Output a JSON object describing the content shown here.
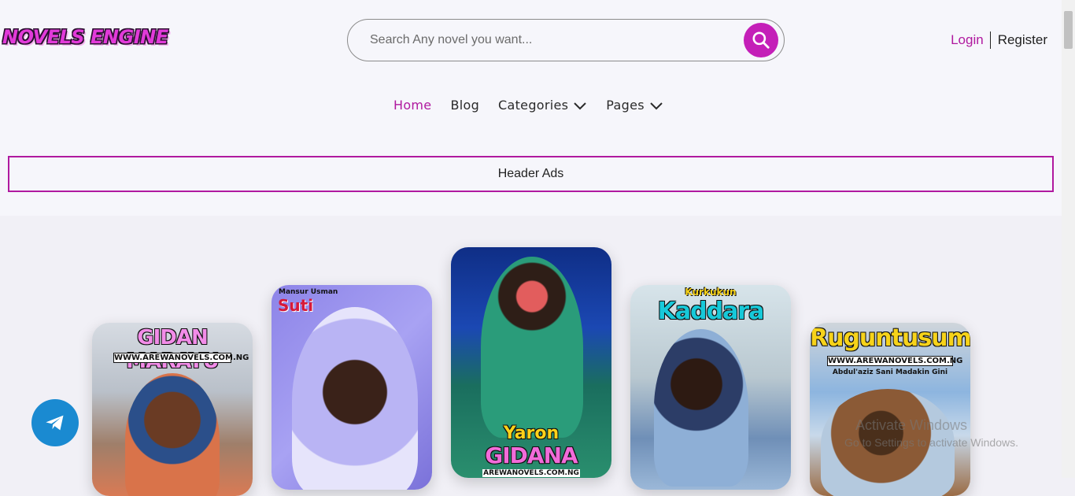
{
  "logo": {
    "text": "NOVELS ENGINE"
  },
  "search": {
    "placeholder": "Search Any novel you want...",
    "icon": "search-icon"
  },
  "auth": {
    "login": "Login",
    "register": "Register"
  },
  "nav": {
    "items": [
      {
        "label": "Home",
        "active": true
      },
      {
        "label": "Blog",
        "active": false
      },
      {
        "label": "Categories",
        "active": false,
        "dropdown": true
      },
      {
        "label": "Pages",
        "active": false,
        "dropdown": true
      }
    ]
  },
  "ads": {
    "label": "Header Ads"
  },
  "covers": [
    {
      "title": "GIDAN MARAYU",
      "site": "WWW.AREWANOVELS.COM.NG"
    },
    {
      "author": "Mansur Usman",
      "title": "Suti"
    },
    {
      "title_line1": "Yaron",
      "title_line2": "GIDANA",
      "site": "AREWANOVELS.COM.NG"
    },
    {
      "subtitle": "Kurkukun",
      "title": "Kaddara"
    },
    {
      "title": "Ruguntusumi",
      "site": "WWW.AREWANOVELS.COM.NG",
      "author": "Abdul'aziz Sani Madakin Gini"
    }
  ],
  "watermark": {
    "line1": "Activate Windows",
    "line2": "Go to Settings to activate Windows."
  },
  "colors": {
    "accent": "#b0199f",
    "search_button": "#c41fb8",
    "telegram": "#1a8ad1"
  }
}
